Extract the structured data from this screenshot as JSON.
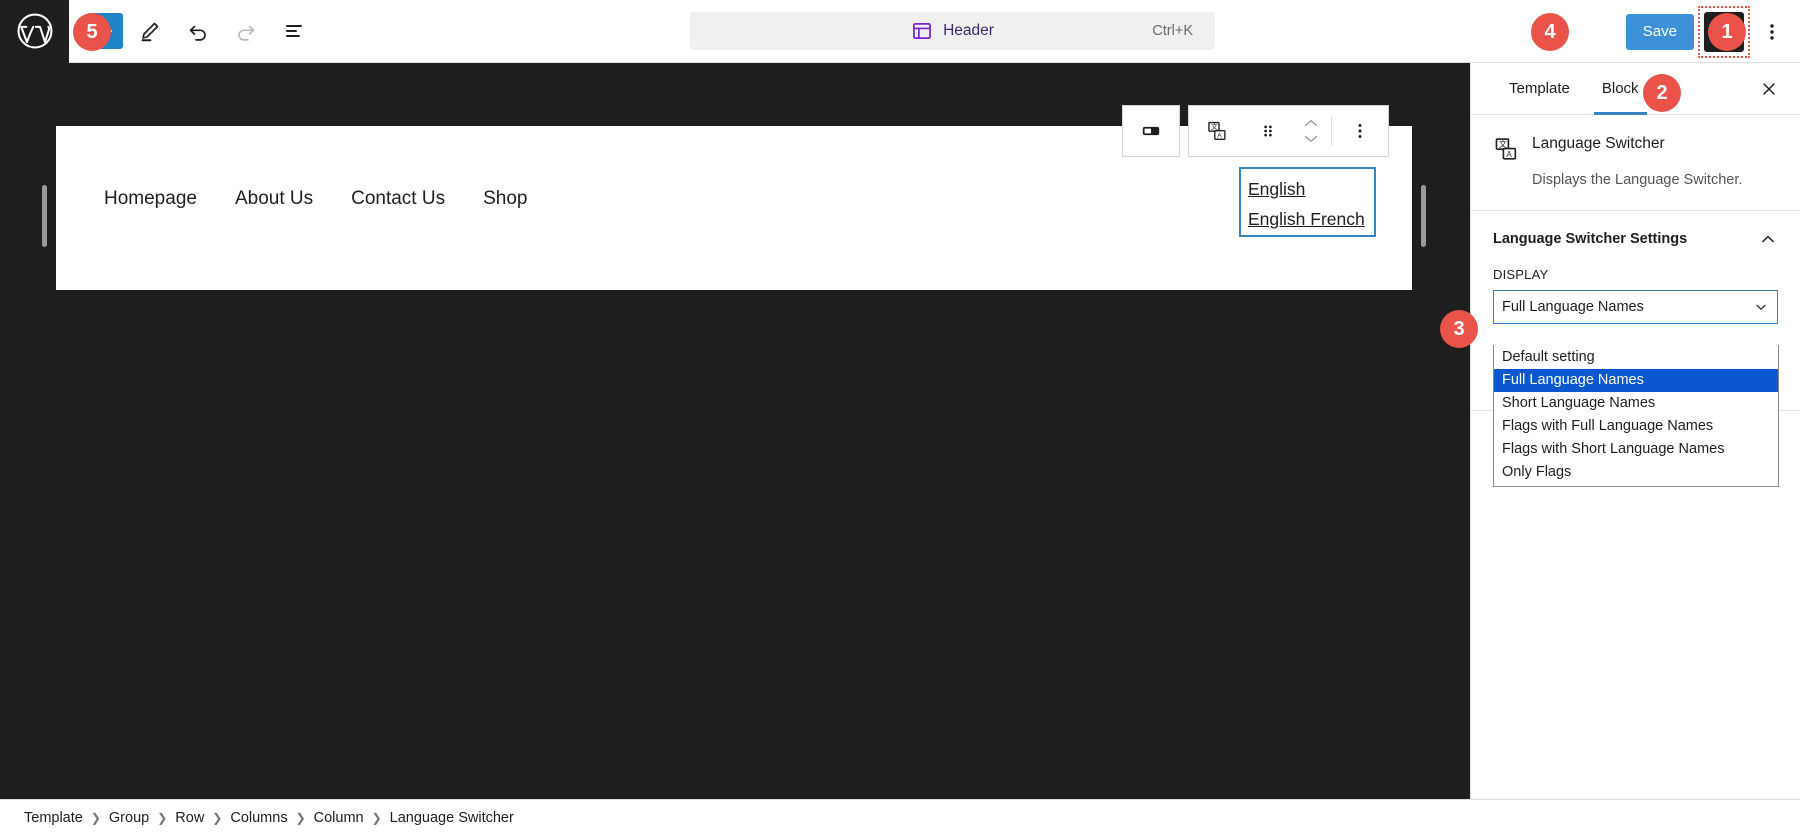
{
  "topbar": {
    "logo_icon": "wordpress-logo",
    "add_block_label": "+",
    "tools": [
      {
        "name": "edit-tool",
        "icon": "pencil-icon"
      },
      {
        "name": "undo",
        "icon": "undo-arrow-icon"
      },
      {
        "name": "redo",
        "icon": "redo-arrow-icon"
      },
      {
        "name": "list-view",
        "icon": "list-view-icon"
      }
    ],
    "command_bar": {
      "doc_icon": "template-header-icon",
      "title": "Header",
      "shortcut": "Ctrl+K"
    },
    "save_label": "Save",
    "sidebar_toggle_icon": "sidebar-panel-icon",
    "more_icon": "ellipsis-vertical-icon"
  },
  "badges": [
    {
      "id": "badge5",
      "number": "5"
    },
    {
      "id": "badge4",
      "number": "4"
    },
    {
      "id": "badge1",
      "number": "1"
    },
    {
      "id": "badge2",
      "number": "2"
    },
    {
      "id": "badge3",
      "number": "3"
    }
  ],
  "canvas": {
    "nav_items": [
      "Homepage",
      "About Us",
      "Contact Us",
      "Shop"
    ],
    "language_switcher_links": [
      "English",
      "English French"
    ]
  },
  "block_toolbar": {
    "buttons": [
      {
        "name": "column-layout-button",
        "icon": "column-layout-icon"
      },
      {
        "name": "block-type-button",
        "icon": "language-switcher-icon"
      },
      {
        "name": "drag-handle",
        "icon": "drag-dots-icon"
      },
      {
        "name": "move-up-down",
        "icon": "chevron-up-down-icon"
      },
      {
        "name": "block-options",
        "icon": "ellipsis-vertical-icon"
      }
    ]
  },
  "sidebar": {
    "tabs": [
      {
        "label": "Template",
        "active": false
      },
      {
        "label": "Block",
        "active": true
      }
    ],
    "close_icon": "close-x-icon",
    "block_card": {
      "icon": "language-switcher-icon",
      "title": "Language Switcher",
      "description": "Displays the Language Switcher."
    },
    "panel": {
      "title": "Language Switcher Settings",
      "collapse_icon": "chevron-up-icon"
    },
    "display_field": {
      "label": "DISPLAY",
      "value": "Full Language Names",
      "chevron_icon": "chevron-down-icon",
      "options": [
        {
          "label": "Default setting",
          "selected": false
        },
        {
          "label": "Full Language Names",
          "selected": true
        },
        {
          "label": "Short Language Names",
          "selected": false
        },
        {
          "label": "Flags with Full Language Names",
          "selected": false
        },
        {
          "label": "Flags with Short Language Names",
          "selected": false
        },
        {
          "label": "Only Flags",
          "selected": false
        }
      ]
    }
  },
  "breadcrumb": {
    "items": [
      "Template",
      "Group",
      "Row",
      "Columns",
      "Column",
      "Language Switcher"
    ],
    "separator": "❯"
  },
  "colors": {
    "badge_red": "#ea5349",
    "save_blue": "#3c91d6",
    "accent_blue": "#3582c4",
    "select_highlight": "#0a57d0",
    "dark_chrome": "#1e1e1e"
  }
}
